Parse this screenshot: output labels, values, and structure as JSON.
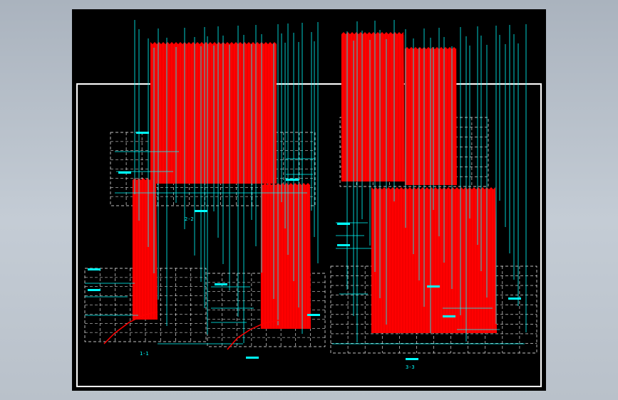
{
  "drawing": {
    "background": "#000000",
    "colors": {
      "fill": "#ff0000",
      "line": "#00ffff",
      "grid": "#ffffff",
      "frame": "#ffffff"
    },
    "section_labels": [
      "2-2",
      "1-1",
      "",
      "3-3"
    ]
  }
}
